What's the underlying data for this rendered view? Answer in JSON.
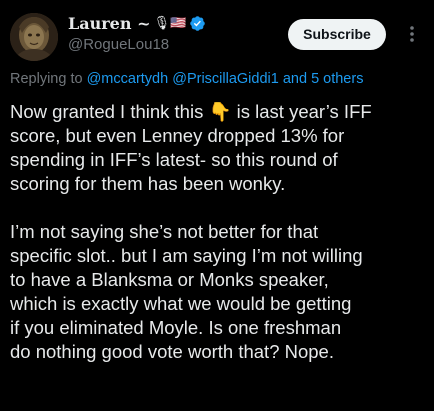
{
  "colors": {
    "background": "#000000",
    "text_primary": "#e7e9ea",
    "text_secondary": "#71767b",
    "link": "#1d9bf0",
    "verified_badge": "#1d9bf0",
    "subscribe_bg": "#eff3f4",
    "subscribe_text": "#0f1419"
  },
  "author": {
    "display_name": "Lauren ~",
    "name_emojis": "🎙🇺🇸",
    "verified_icon": "verified-badge-icon",
    "handle": "@RogueLou18",
    "avatar_icon": "profile-photo"
  },
  "actions": {
    "subscribe_label": "Subscribe",
    "more_icon": "more-vertical-icon"
  },
  "reply": {
    "prefix": "Replying to ",
    "mention_1": "@mccartydh",
    "mention_2": "@PriscillaGiddi1",
    "joiner": " and ",
    "others": "5 others"
  },
  "tweet": {
    "p1": {
      "line1_a": "Now granted I think this ",
      "emoji": "👇",
      "line1_b": " is last year’s IFF",
      "line2": "score, but even Lenney dropped 13% for",
      "line3": "spending in IFF’s latest- so this round of",
      "line4": "scoring for them has been wonky."
    },
    "p2": {
      "line1": "I’m not saying she’s not better for that",
      "line2": "specific slot.. but I am saying I’m not willing",
      "line3": "to have a Blanksma or Monks speaker,",
      "line4": "which is exactly what we would be getting",
      "line5": "if you eliminated Moyle. Is one freshman",
      "line6": "do nothing good vote worth that? Nope."
    }
  }
}
